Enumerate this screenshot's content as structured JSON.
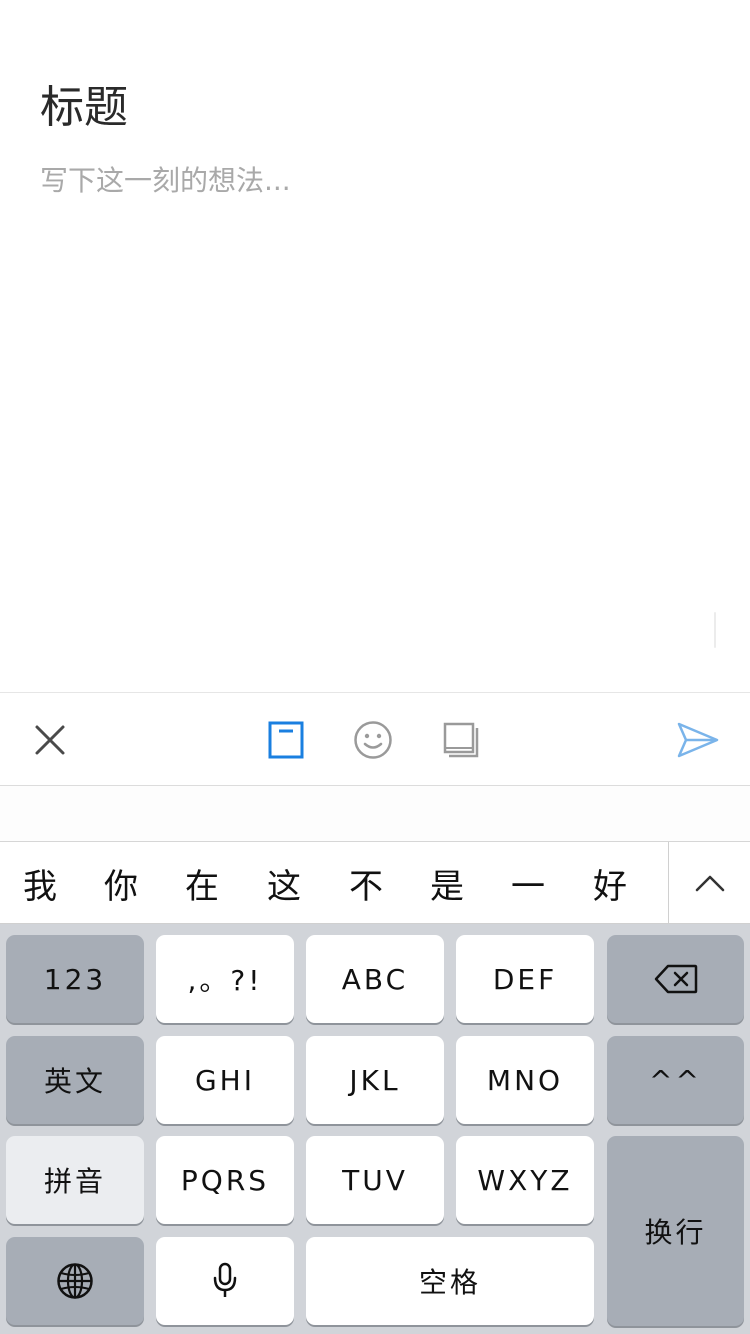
{
  "editor": {
    "title": "标题",
    "body_placeholder": "写下这一刻的想法..."
  },
  "toolbar": {
    "icons": [
      "close-icon",
      "format-icon",
      "emoji-icon",
      "book-icon",
      "send-icon"
    ],
    "accent_color": "#1a7fe0",
    "send_color": "#7ab4ea"
  },
  "candidates": {
    "items": [
      "我",
      "你",
      "在",
      "这",
      "不",
      "是",
      "一",
      "好"
    ],
    "expand_icon": "chevron-up-icon"
  },
  "keyboard": {
    "row1": [
      "123",
      ",。?!",
      "ABC",
      "DEF"
    ],
    "row2": [
      "英文",
      "GHI",
      "JKL",
      "MNO",
      "^^"
    ],
    "row3": [
      "拼音",
      "PQRS",
      "TUV",
      "WXYZ"
    ],
    "return_label": "换行",
    "space_label": "空格",
    "icons": [
      "globe-icon",
      "microphone-icon",
      "backspace-icon"
    ]
  }
}
